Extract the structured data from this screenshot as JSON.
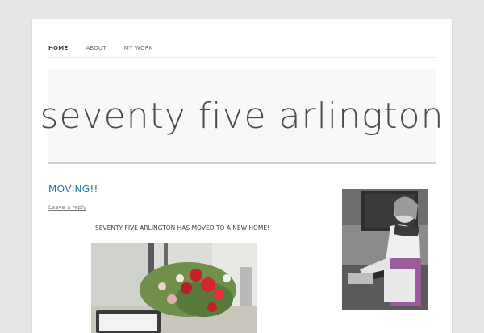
{
  "nav": {
    "items": [
      {
        "label": "HOME",
        "active": true
      },
      {
        "label": "ABOUT",
        "active": false
      },
      {
        "label": "MY WORK",
        "active": false
      }
    ]
  },
  "banner": {
    "title": "seventy five arlington"
  },
  "post": {
    "title": "MOVING!!",
    "reply_link": "Leave a reply",
    "text": "SEVENTY FIVE ARLINGTON HAS MOVED TO A NEW HOME!"
  }
}
